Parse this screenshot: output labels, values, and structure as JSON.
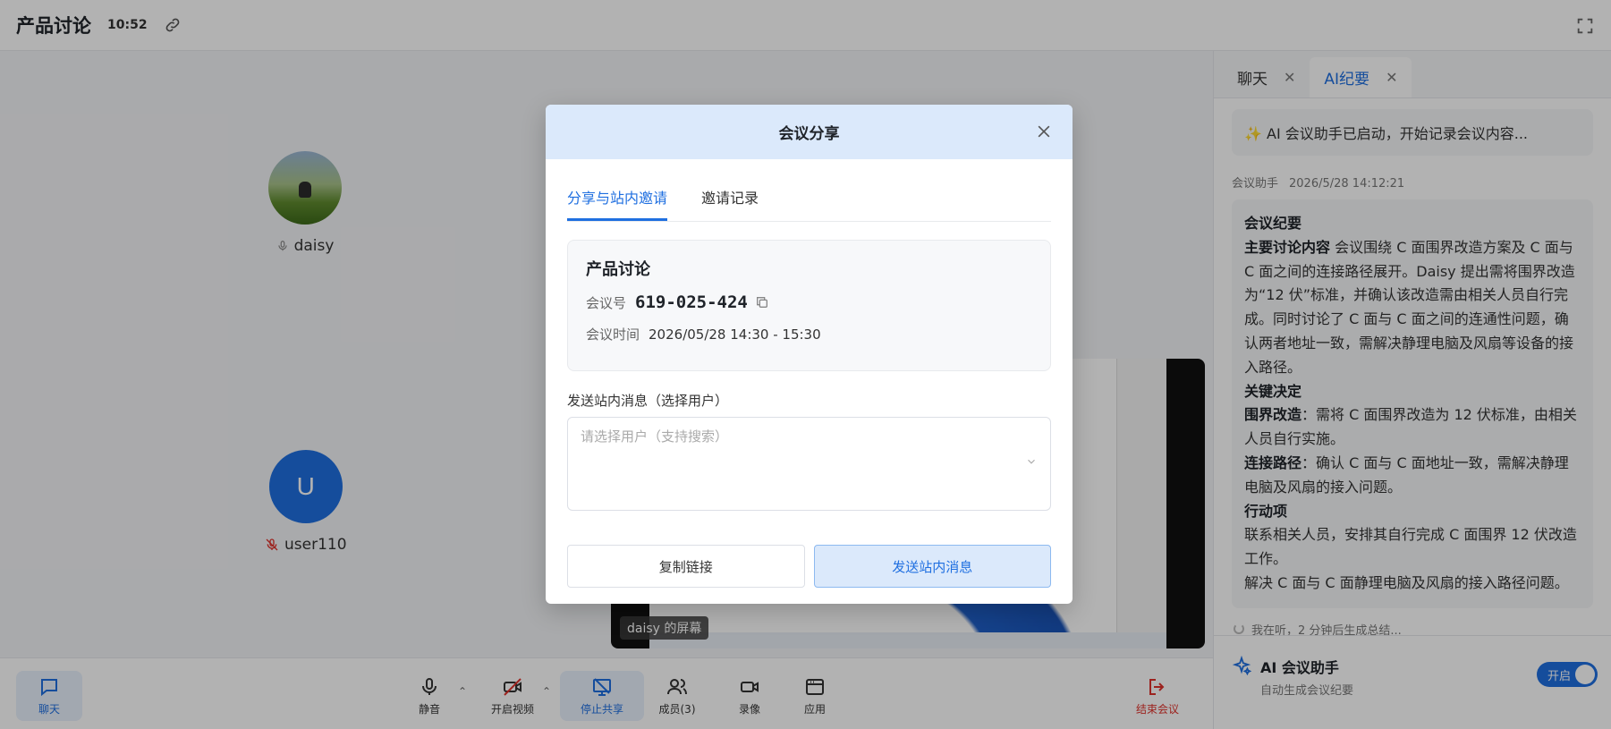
{
  "header": {
    "title": "产品讨论",
    "time": "10:52"
  },
  "participants": [
    {
      "name": "daisy",
      "avatar": "photo",
      "mic": "on"
    },
    {
      "name": "user110",
      "avatar_letter": "U",
      "mic": "muted"
    }
  ],
  "screenshare": {
    "label": "daisy 的屏幕"
  },
  "toolbar": {
    "chat": "聊天",
    "mute": "静音",
    "video": "开启视频",
    "stop_share": "停止共享",
    "members": "成员(3)",
    "record": "录像",
    "apps": "应用",
    "end": "结束会议"
  },
  "panel": {
    "tabs": [
      {
        "label": "聊天",
        "active": false
      },
      {
        "label": "AI纪要",
        "active": true
      }
    ],
    "notice": "✨ AI 会议助手已启动，开始记录会议内容...",
    "meta": {
      "author": "会议助手",
      "time": "2026/5/28 14:12:21"
    },
    "summary": {
      "heading": "会议纪要",
      "main_label": "主要讨论内容",
      "main_text": " 会议围绕 C 面围界改造方案及 C 面与 C 面之间的连接路径展开。Daisy 提出需将围界改造为“12 伏”标准，并确认该改造需由相关人员自行完成。同时讨论了 C 面与 C 面之间的连通性问题，确认两者地址一致，需解决静理电脑及风扇等设备的接入路径。",
      "decisions_heading": "关键决定",
      "decision1_label": "围界改造",
      "decision1_text": "：需将 C 面围界改造为 12 伏标准，由相关人员自行实施。",
      "decision2_label": "连接路径",
      "decision2_text": "：确认 C 面与 C 面地址一致，需解决静理电脑及风扇的接入问题。",
      "actions_heading": "行动项",
      "action1": "联系相关人员，安排其自行完成 C 面围界 12 伏改造工作。",
      "action2": "解决 C 面与 C 面静理电脑及风扇的接入路径问题。"
    },
    "listening": "我在听，2 分钟后生成总结...",
    "assistant": {
      "title": "AI 会议助手",
      "subtitle": "自动生成会议纪要",
      "toggle": "开启"
    }
  },
  "modal": {
    "title": "会议分享",
    "tabs": [
      "分享与站内邀请",
      "邀请记录"
    ],
    "meeting_name": "产品讨论",
    "id_label": "会议号",
    "id_value": "619-025-424",
    "time_label": "会议时间",
    "time_value": "2026/05/28 14:30 - 15:30",
    "field_label": "发送站内消息（选择用户）",
    "select_placeholder": "请选择用户（支持搜索）",
    "copy_button": "复制链接",
    "send_button": "发送站内消息"
  },
  "colors": {
    "accent": "#1f6fe0",
    "danger": "#e0322b",
    "modal_header": "#dbe9fb"
  }
}
